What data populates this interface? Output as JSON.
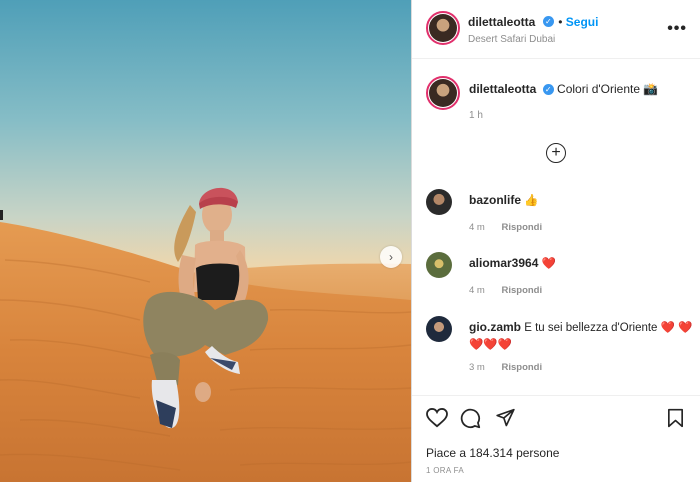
{
  "post": {
    "username": "dilettaleotta",
    "location": "Desert Safari Dubai",
    "follow_label": "Segui",
    "more_label": "•••",
    "caption": "Colori d'Oriente",
    "caption_emoji": "📸",
    "caption_time": "1 h",
    "add_label": "+"
  },
  "comments": [
    {
      "username": "bazonlife",
      "text": "👍",
      "time": "4 m",
      "reply": "Rispondi"
    },
    {
      "username": "aliomar3964",
      "text": "❤️",
      "time": "4 m",
      "reply": "Rispondi"
    },
    {
      "username": "gio.zamb",
      "text": "E tu sei bellezza d'Oriente ❤️ ❤️❤️❤️❤️",
      "time": "3 m",
      "reply": "Rispondi"
    }
  ],
  "footer": {
    "likes": "Piace a 184.314 persone",
    "time_ago": "1 ORA FA"
  },
  "icons": {
    "like": "heart-icon",
    "comment": "comment-icon",
    "share": "share-icon",
    "save": "bookmark-icon",
    "next": "chevron-right-icon"
  },
  "colors": {
    "accent": "#0095f6",
    "verified": "#3897f0",
    "heart": "#ed2f3a",
    "story_ring": "#e1306c"
  }
}
